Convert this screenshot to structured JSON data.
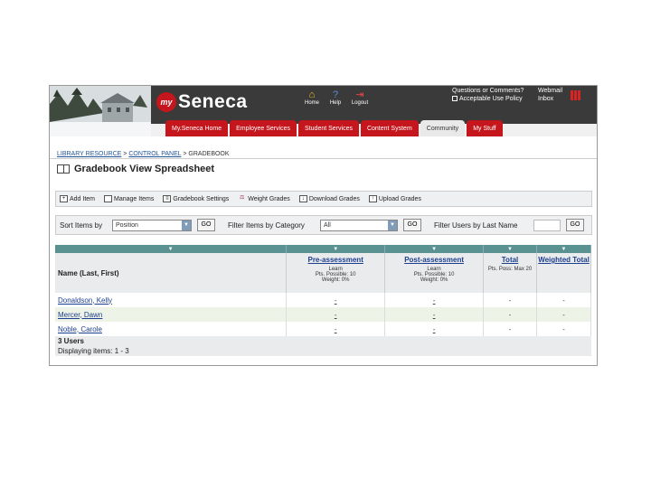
{
  "header": {
    "logo_prefix": "my",
    "logo_name": "Seneca",
    "icons": [
      {
        "label": "Home",
        "icon": "home-icon"
      },
      {
        "label": "Help",
        "icon": "help-icon"
      },
      {
        "label": "Logout",
        "icon": "logout-icon"
      }
    ],
    "questions_line1": "Questions or Comments?",
    "questions_line2": "Acceptable Use Policy",
    "webmail_line1": "Webmail",
    "webmail_line2": "Inbox"
  },
  "tabs": [
    {
      "label": "My.Seneca Home",
      "active": false
    },
    {
      "label": "Employee Services",
      "active": false
    },
    {
      "label": "Student Services",
      "active": false
    },
    {
      "label": "Content System",
      "active": false
    },
    {
      "label": "Community",
      "active": true
    },
    {
      "label": "My Stuff",
      "active": false
    }
  ],
  "breadcrumb": {
    "link1": "LIBRARY RESOURCE",
    "link2": "CONTROL PANEL",
    "current": "GRADEBOOK"
  },
  "page_title": "Gradebook View Spreadsheet",
  "actions": [
    {
      "label": "Add Item",
      "icon": "add-item-icon"
    },
    {
      "label": "Manage Items",
      "icon": "manage-items-icon"
    },
    {
      "label": "Gradebook Settings",
      "icon": "settings-icon"
    },
    {
      "label": "Weight Grades",
      "icon": "weight-icon"
    },
    {
      "label": "Download Grades",
      "icon": "download-icon"
    },
    {
      "label": "Upload Grades",
      "icon": "upload-icon"
    }
  ],
  "filters": {
    "sort_label": "Sort Items by",
    "sort_value": "Position",
    "filter_label": "Filter Items by Category",
    "filter_value": "All",
    "users_label": "Filter Users by Last Name",
    "users_value": "",
    "go": "GO"
  },
  "grid": {
    "name_header": "Name (Last, First)",
    "columns": [
      {
        "name": "Pre-assessment",
        "line1": "Learn",
        "line2": "Pts. Possible: 10",
        "line3": "Weight: 0%"
      },
      {
        "name": "Post-assessment",
        "line1": "Learn",
        "line2": "Pts. Possible: 10",
        "line3": "Weight: 0%"
      },
      {
        "name": "Total",
        "line1": "",
        "line2": "Pts. Poss: Max 20",
        "line3": ""
      },
      {
        "name": "Weighted Total",
        "line1": "",
        "line2": "",
        "line3": ""
      }
    ],
    "rows": [
      {
        "name": "Donaldson, Kelly",
        "pre": "-",
        "post": "-",
        "total": "-",
        "weighted": "-"
      },
      {
        "name": "Mercer, Dawn",
        "pre": "-",
        "post": "-",
        "total": "-",
        "weighted": "-"
      },
      {
        "name": "Noble, Carole",
        "pre": "-",
        "post": "-",
        "total": "-",
        "weighted": "-"
      }
    ],
    "footer_users": "3 Users",
    "footer_range": "Displaying items: 1 - 3"
  },
  "colors": {
    "brand_red": "#c4161c",
    "header_dark": "#3a3a3a",
    "grid_teal": "#5a9291",
    "link_blue": "#1d3f8f"
  }
}
